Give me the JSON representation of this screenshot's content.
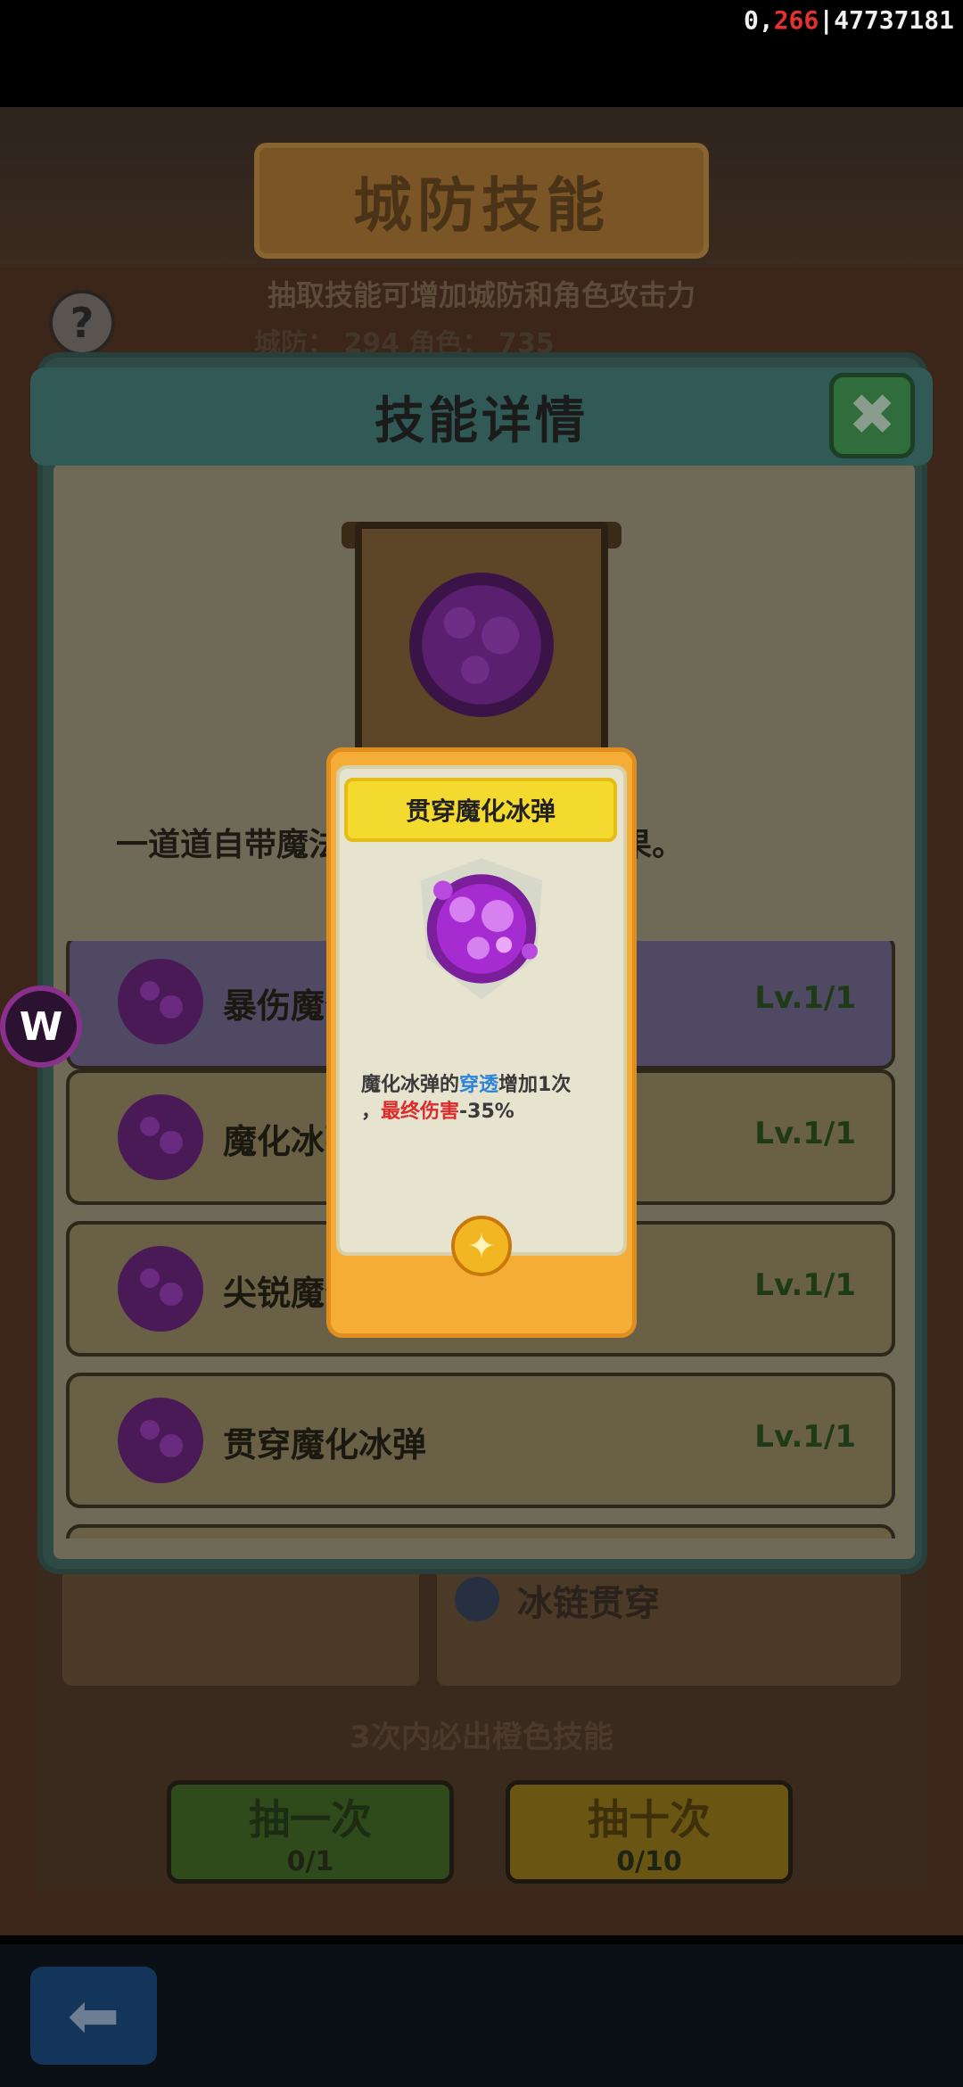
{
  "counter": {
    "prefix": "0,",
    "red": "266",
    "suffix": "|47737181"
  },
  "background": {
    "title": "城防技能",
    "subtitle": "抽取技能可增加城防和角色攻击力",
    "stats": "城防： 294   角色： 735",
    "help_symbol": "?",
    "ice_chain_label": "冰链贯穿",
    "guarantee": "3次内必出橙色技能",
    "draw_one": {
      "label": "抽一次",
      "count": "0/1"
    },
    "draw_ten": {
      "label": "抽十次",
      "count": "0/10"
    },
    "back_symbol": "⬅"
  },
  "w_icon_letter": "W",
  "detail": {
    "title": "技能详情",
    "close_symbol": "✖",
    "description": "一道道自带魔法  性伤害。还能附带   果。"
  },
  "skills": [
    {
      "name": "暴伤魔化",
      "level": "Lv.1/1",
      "selected": true
    },
    {
      "name": "魔化冰弹",
      "level": "Lv.1/1",
      "selected": false
    },
    {
      "name": "尖锐魔化",
      "level": "Lv.1/1",
      "selected": false
    },
    {
      "name": "贯穿魔化冰弹",
      "level": "Lv.1/1",
      "selected": false
    }
  ],
  "popup": {
    "title": "贯穿魔化冰弹",
    "desc_part1": "魔化冰弹的",
    "desc_blue": "穿透",
    "desc_part2": "增加1次",
    "desc_part3": "，",
    "desc_red": "最终伤害",
    "desc_part4": "-35%",
    "star_symbol": "✦"
  },
  "colors": {
    "accent_orange": "#f6ad38",
    "title_yellow": "#f4d92e",
    "orb_purple": "#9b2fc4"
  }
}
